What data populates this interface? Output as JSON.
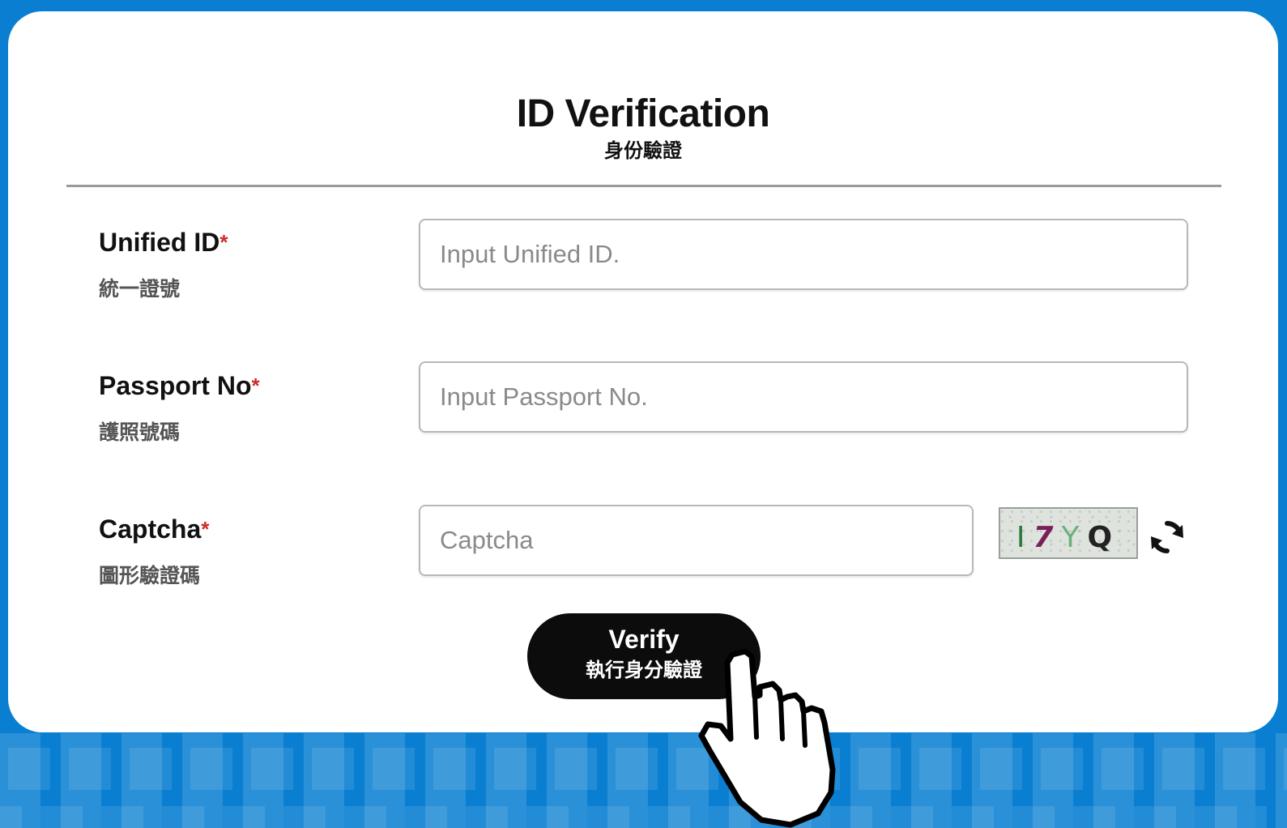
{
  "header": {
    "title": "ID Verification",
    "subtitle": "身份驗證"
  },
  "fields": {
    "unified_id": {
      "label": "Unified ID",
      "required_mark": "*",
      "label_zh": "統一證號",
      "placeholder": "Input Unified ID.",
      "value": ""
    },
    "passport_no": {
      "label": "Passport No",
      "required_mark": "*",
      "label_zh": "護照號碼",
      "placeholder": "Input Passport No.",
      "value": ""
    },
    "captcha": {
      "label": "Captcha",
      "required_mark": "*",
      "label_zh": "圖形驗證碼",
      "placeholder": "Captcha",
      "value": "",
      "image_chars": [
        "I",
        "7",
        "Y",
        "Q"
      ],
      "refresh_icon": "refresh-icon"
    }
  },
  "verify_button": {
    "label": "Verify",
    "label_zh": "執行身分驗證"
  },
  "colors": {
    "background": "#0a7fd1",
    "card": "#ffffff",
    "required": "#d12a2a",
    "button": "#0c0c0c"
  },
  "icons": {
    "cursor": "pointing-hand-cursor-icon"
  }
}
